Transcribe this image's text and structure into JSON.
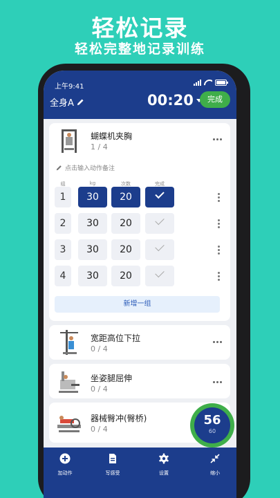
{
  "promo": {
    "title": "轻松记录",
    "subtitle": "轻松完整地记录训练"
  },
  "status_bar": {
    "time": "上午9:41"
  },
  "header": {
    "plan_name": "全身A",
    "timer": "00:20",
    "done_label": "完成"
  },
  "main_exercise": {
    "name": "蝴蝶机夹胸",
    "progress": "1 / 4",
    "note_placeholder": "点击输入动作备注",
    "columns": {
      "set": "组",
      "weight": "kg",
      "reps": "次数",
      "done": "完成"
    },
    "sets": [
      {
        "index": "1",
        "weight": "30",
        "reps": "20",
        "done": true
      },
      {
        "index": "2",
        "weight": "30",
        "reps": "20",
        "done": false
      },
      {
        "index": "3",
        "weight": "30",
        "reps": "20",
        "done": false
      },
      {
        "index": "4",
        "weight": "30",
        "reps": "20",
        "done": false
      }
    ],
    "add_set_label": "新增一组"
  },
  "exercises": [
    {
      "name": "宽距高位下拉",
      "progress": "0 / 4"
    },
    {
      "name": "坐姿腿屈伸",
      "progress": "0 / 4"
    },
    {
      "name": "器械臀冲(臀桥)",
      "progress": "0 / 4"
    }
  ],
  "rest_timer": {
    "remaining": "56",
    "total": "60"
  },
  "tabbar": [
    {
      "label": "加动作",
      "icon": "plus-circle-icon"
    },
    {
      "label": "写感受",
      "icon": "document-icon"
    },
    {
      "label": "设置",
      "icon": "gear-icon"
    },
    {
      "label": "缩小",
      "icon": "shrink-arrows-icon"
    }
  ],
  "colors": {
    "background": "#2ecfb8",
    "primary": "#1c3d8c",
    "accent": "#3fae4a",
    "completed_cell": "#1c3d8c",
    "pending_cell": "#eef0f5"
  }
}
